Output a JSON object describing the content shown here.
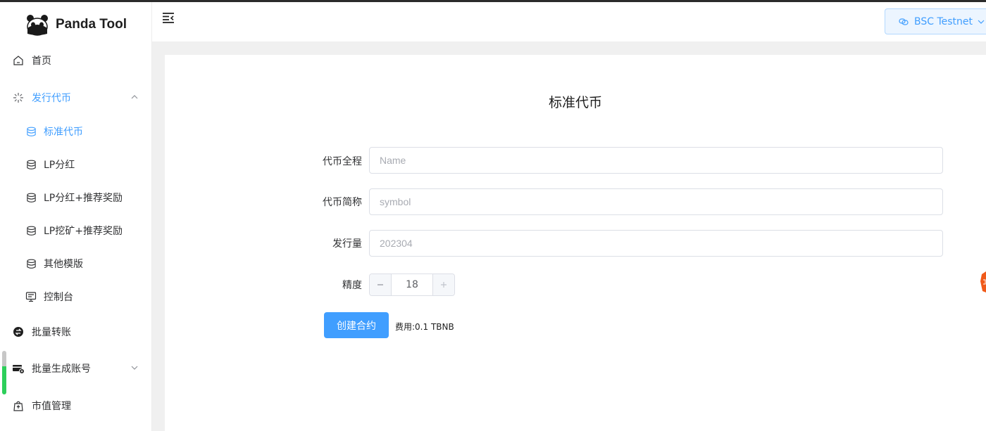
{
  "app": {
    "name": "Panda Tool"
  },
  "sidebar": {
    "items": [
      {
        "label": "首页",
        "icon": "home-icon"
      },
      {
        "label": "发行代币",
        "icon": "sparkle-icon",
        "expanded": true
      },
      {
        "label": "标准代币",
        "icon": "database-icon",
        "active": true
      },
      {
        "label": "LP分红",
        "icon": "database-icon"
      },
      {
        "label": "LP分红+推荐奖励",
        "icon": "database-icon"
      },
      {
        "label": "LP挖矿+推荐奖励",
        "icon": "database-icon"
      },
      {
        "label": "其他模版",
        "icon": "database-icon"
      },
      {
        "label": "控制台",
        "icon": "monitor-icon"
      },
      {
        "label": "批量转账",
        "icon": "transfer-icon"
      },
      {
        "label": "批量生成账号",
        "icon": "card-add-icon",
        "expanded": false
      },
      {
        "label": "市值管理",
        "icon": "bag-icon"
      }
    ]
  },
  "header": {
    "network_label": "BSC Testnet"
  },
  "main": {
    "title": "标准代币",
    "fields": {
      "name": {
        "label": "代币全程",
        "placeholder": "Name"
      },
      "symbol": {
        "label": "代币简称",
        "placeholder": "symbol"
      },
      "supply": {
        "label": "发行量",
        "placeholder": "202304"
      },
      "decimals": {
        "label": "精度",
        "value": "18"
      }
    },
    "create_button": "创建合约",
    "fee": "费用:0.1 TBNB"
  },
  "colors": {
    "accent": "#409eff",
    "background": "#f0f0f0"
  }
}
